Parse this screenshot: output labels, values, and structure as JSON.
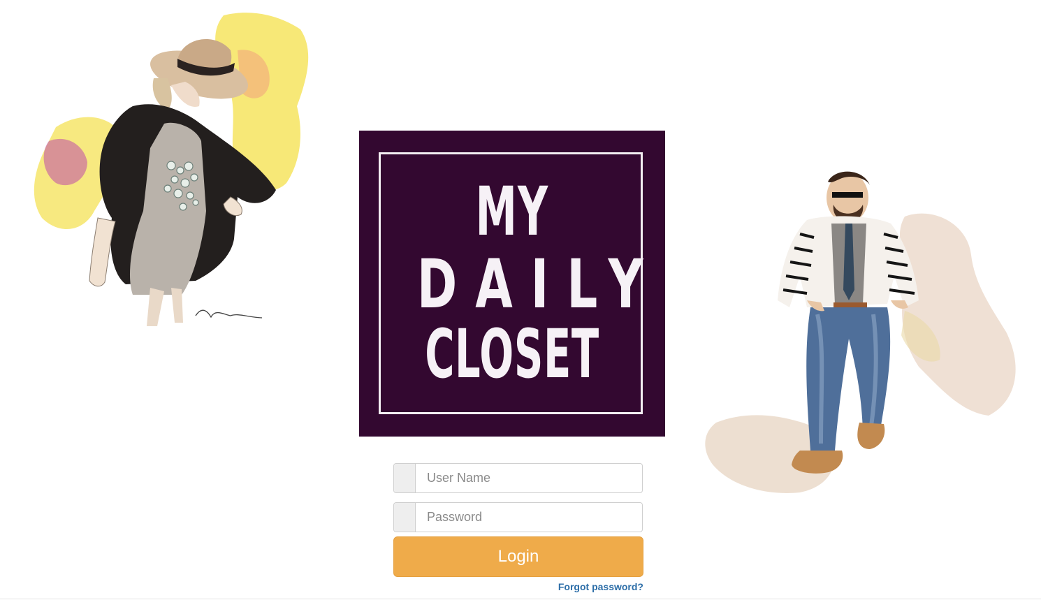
{
  "logo": {
    "line1": "MY",
    "line2": "DAILY",
    "line3": "CLOSET",
    "background_color": "#330830"
  },
  "illustrations": {
    "left": "woman-fashion-sketch-illustration",
    "right": "man-fashion-sketch-illustration"
  },
  "login_form": {
    "username_placeholder": "User Name",
    "username_value": "",
    "password_placeholder": "Password",
    "password_value": "",
    "login_label": "Login",
    "forgot_label": "Forgot password?",
    "button_color": "#efab4a",
    "link_color": "#2d6ea8"
  }
}
